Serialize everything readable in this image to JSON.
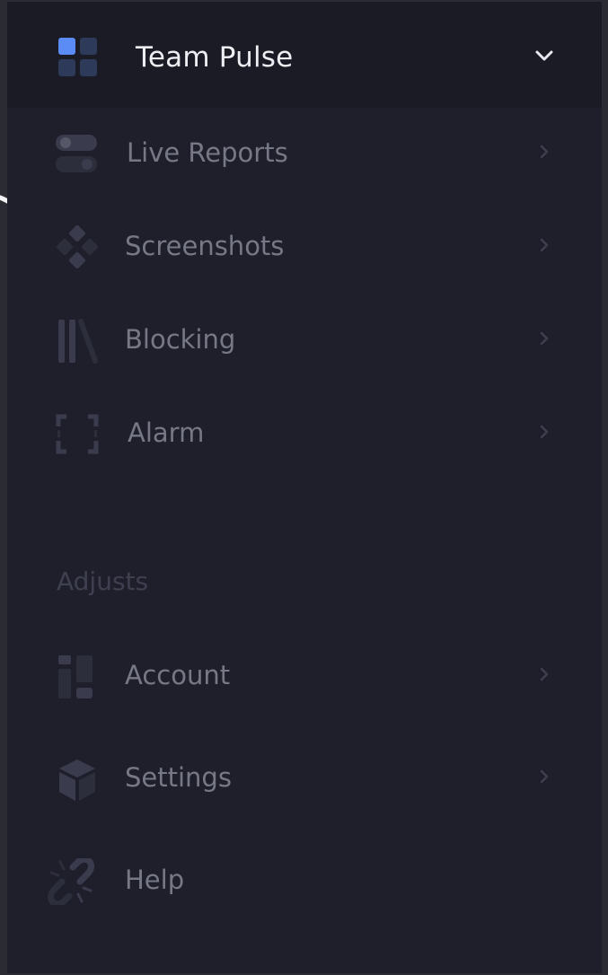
{
  "header": {
    "title": "Team Pulse",
    "brand_icon": "grid-apps-icon",
    "toggle_icon": "chevron-down-icon"
  },
  "nav": [
    {
      "label": "Live Reports",
      "icon": "toggles-icon"
    },
    {
      "label": "Screenshots",
      "icon": "diamonds-icon"
    },
    {
      "label": "Blocking",
      "icon": "books-icon"
    },
    {
      "label": "Alarm",
      "icon": "frame-brackets-icon"
    }
  ],
  "adjusts": {
    "section_label": "Adjusts",
    "items": [
      {
        "label": "Account",
        "icon": "layout-blocks-icon"
      },
      {
        "label": "Settings",
        "icon": "cube-icon"
      },
      {
        "label": "Help",
        "icon": "broken-link-icon"
      }
    ]
  },
  "colors": {
    "sidebar_bg": "#1f1f2c",
    "header_bg": "#1b1b26",
    "accent": "#5b8cf5",
    "text_primary": "#ededf2",
    "text_muted": "#767886",
    "icon_muted": "#3a3c4d"
  }
}
